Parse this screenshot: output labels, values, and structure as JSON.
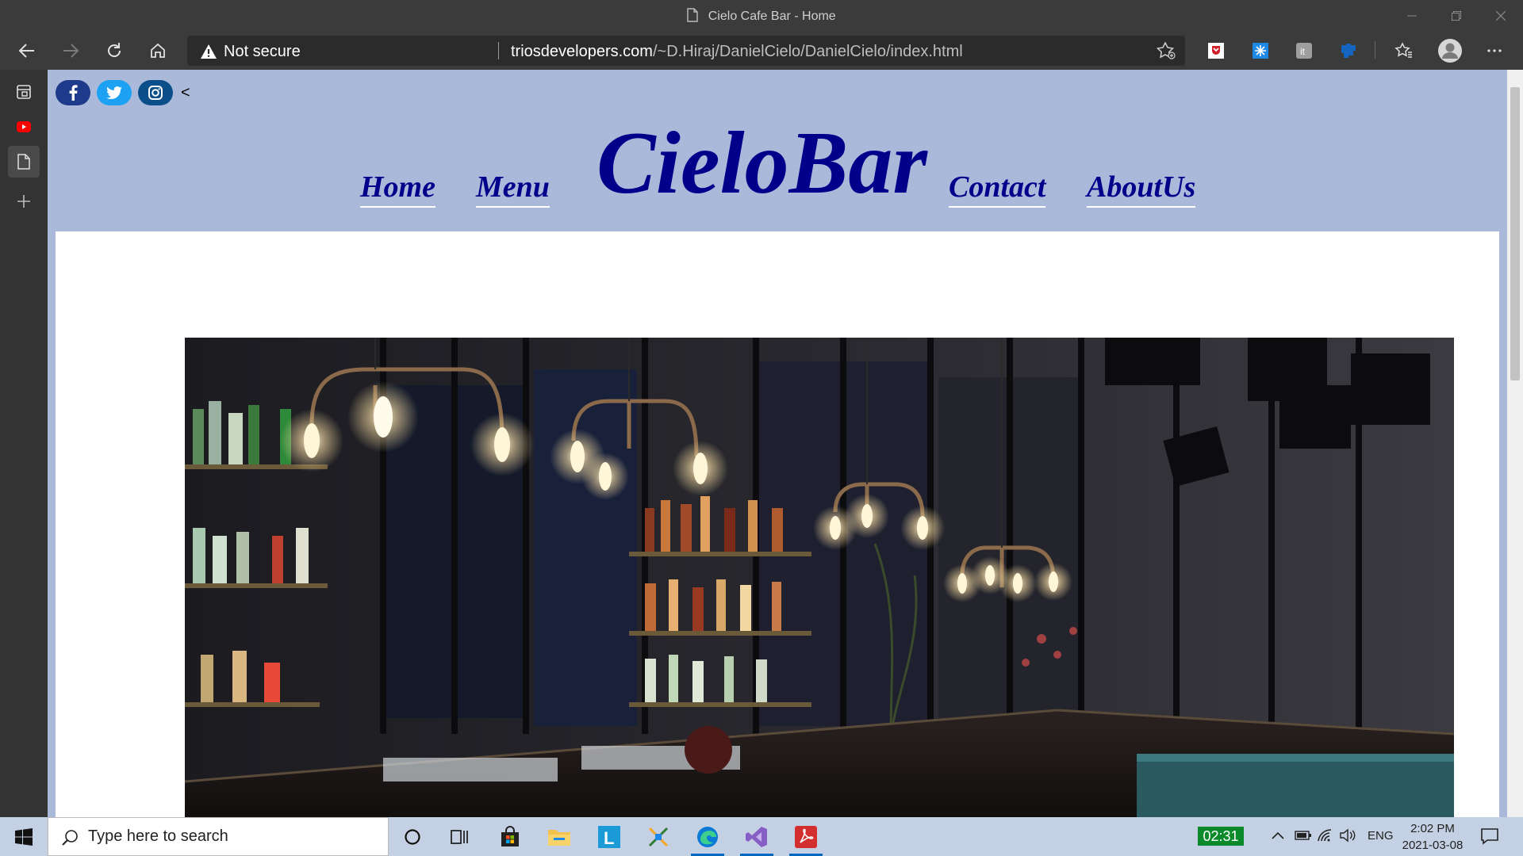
{
  "window": {
    "title": "Cielo Cafe Bar - Home"
  },
  "toolbar": {
    "security_label": "Not secure",
    "url_host": "triosdevelopers.com",
    "url_path": "/~D.Hiraj/DanielCielo/DanielCielo/index.html"
  },
  "page": {
    "social_extra": "<",
    "nav": {
      "home": "Home",
      "menu": "Menu",
      "logo": "CieloBar",
      "contact": "Contact",
      "about": "AboutUs"
    }
  },
  "taskbar": {
    "search_placeholder": "Type here to search",
    "timer": "02:31",
    "language": "ENG",
    "time": "2:02 PM",
    "date": "2021-03-08"
  },
  "colors": {
    "page_bg": "#aab9da",
    "nav_text": "#00008b",
    "browser_chrome": "#3b3b3b"
  }
}
